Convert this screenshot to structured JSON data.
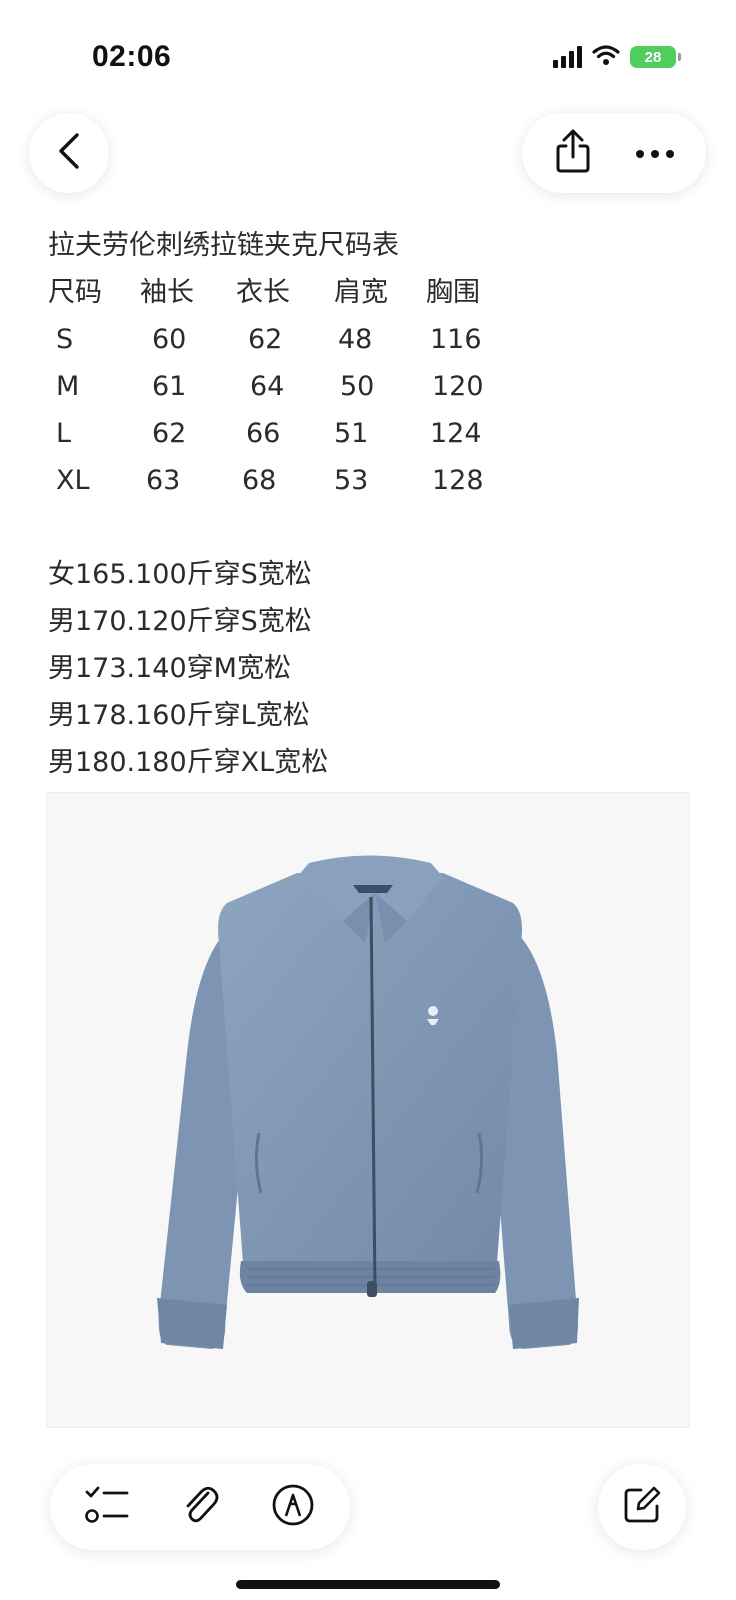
{
  "status_bar": {
    "time": "02:06",
    "battery": "28",
    "battery_color": "#4fce5d"
  },
  "nav": {
    "back_icon": "chevron-left-icon",
    "share_icon": "share-icon",
    "more_icon": "more-horizontal-icon"
  },
  "note": {
    "title": "拉夫劳伦刺绣拉链夹克尺码表",
    "size_table": {
      "headers": [
        "尺码",
        "袖长",
        "衣长",
        "肩宽",
        "胸围"
      ],
      "rows": [
        [
          "S",
          "60",
          "62",
          "48",
          "116"
        ],
        [
          "M",
          "61",
          "64",
          "50",
          "120"
        ],
        [
          "L",
          "62",
          "66",
          "51",
          "124"
        ],
        [
          "XL",
          "63",
          "68",
          "53",
          "128"
        ]
      ]
    },
    "recommendations": [
      "女165.100斤穿S宽松",
      "男170.120斤穿S宽松",
      "男173.140穿M宽松",
      "男178.160斤穿L宽松",
      "男180.180斤穿XL宽松"
    ]
  },
  "product_image": {
    "subject": "blue zip-up jacket",
    "color": "#7f97b4"
  },
  "toolbar": {
    "checklist_icon": "checklist-icon",
    "attachment_icon": "paperclip-icon",
    "markup_icon": "pen-markup-icon",
    "compose_icon": "compose-icon"
  }
}
